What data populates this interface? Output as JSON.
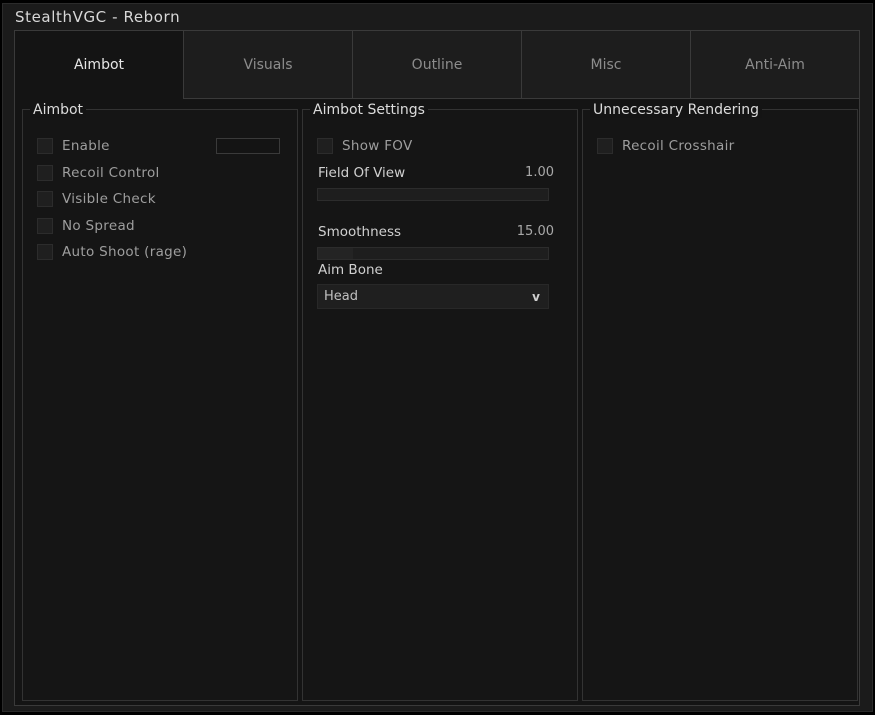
{
  "window": {
    "title": "StealthVGC - Reborn"
  },
  "tabs": [
    {
      "label": "Aimbot",
      "active": true
    },
    {
      "label": "Visuals",
      "active": false
    },
    {
      "label": "Outline",
      "active": false
    },
    {
      "label": "Misc",
      "active": false
    },
    {
      "label": "Anti-Aim",
      "active": false
    }
  ],
  "aimbot": {
    "title": "Aimbot",
    "options": [
      {
        "label": "Enable",
        "checked": false
      },
      {
        "label": "Recoil Control",
        "checked": false
      },
      {
        "label": "Visible Check",
        "checked": false
      },
      {
        "label": "No Spread",
        "checked": false
      },
      {
        "label": "Auto Shoot (rage)",
        "checked": false
      }
    ]
  },
  "settings": {
    "title": "Aimbot Settings",
    "show_fov": {
      "label": "Show FOV",
      "checked": false
    },
    "fov": {
      "label": "Field Of View",
      "value": "1.00",
      "fraction": 0.0
    },
    "smoothness": {
      "label": "Smoothness",
      "value": "15.00",
      "fraction": 0.15
    },
    "aim_bone": {
      "label": "Aim Bone",
      "selected": "Head"
    },
    "chevron_glyph": "v"
  },
  "rendering": {
    "title": "Unnecessary Rendering",
    "options": [
      {
        "label": "Recoil Crosshair",
        "checked": false
      }
    ]
  },
  "icons": {
    "dropdown": "chevron-down-icon"
  },
  "colors": {
    "background": "#141414",
    "border": "#3a3a3a",
    "text": "#c8c8c8"
  }
}
